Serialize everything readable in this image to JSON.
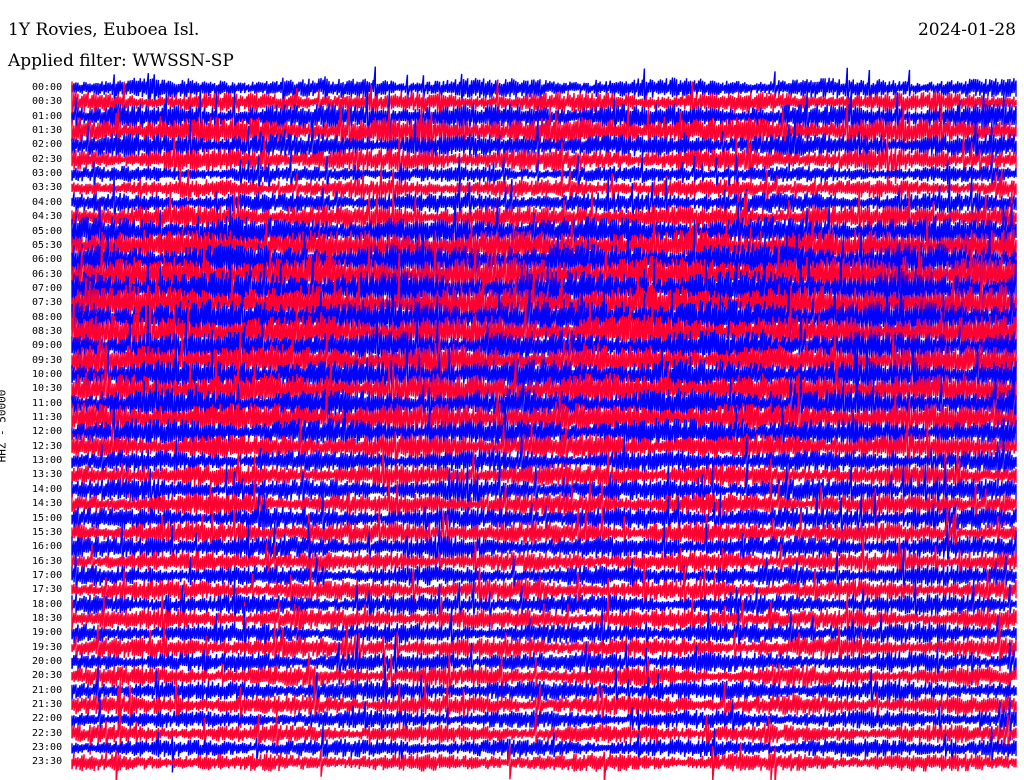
{
  "header": {
    "title": "1Y Rovies, Euboea Isl.",
    "date": "2024-01-28",
    "filter": "Applied filter: WWSSN-SP"
  },
  "chart_data": {
    "type": "line",
    "ylabel": "HHZ - 50000",
    "trace_labels": [
      "00:00",
      "00:30",
      "01:00",
      "01:30",
      "02:00",
      "02:30",
      "03:00",
      "03:30",
      "04:00",
      "04:30",
      "05:00",
      "05:30",
      "06:00",
      "06:30",
      "07:00",
      "07:30",
      "08:00",
      "08:30",
      "09:00",
      "09:30",
      "10:00",
      "10:30",
      "11:00",
      "11:30",
      "12:00",
      "12:30",
      "13:00",
      "13:30",
      "14:00",
      "14:30",
      "15:00",
      "15:30",
      "16:00",
      "16:30",
      "17:00",
      "17:30",
      "18:00",
      "18:30",
      "19:00",
      "19:30",
      "20:00",
      "20:30",
      "21:00",
      "21:30",
      "22:00",
      "22:30",
      "23:00",
      "23:30"
    ],
    "colors": [
      "#0000ff",
      "#ff0033"
    ],
    "trace_amplitude": [
      1.0,
      1.0,
      1.3,
      1.4,
      1.2,
      1.1,
      0.8,
      0.9,
      1.0,
      1.2,
      1.5,
      1.6,
      1.7,
      1.8,
      1.8,
      1.8,
      1.8,
      1.7,
      1.6,
      1.6,
      1.6,
      1.6,
      1.5,
      1.5,
      1.4,
      1.3,
      1.1,
      1.1,
      1.1,
      1.1,
      1.1,
      1.1,
      1.1,
      1.0,
      1.0,
      1.0,
      1.0,
      1.0,
      1.0,
      1.0,
      1.0,
      1.0,
      1.0,
      1.0,
      0.9,
      0.9,
      0.9,
      0.9
    ]
  }
}
